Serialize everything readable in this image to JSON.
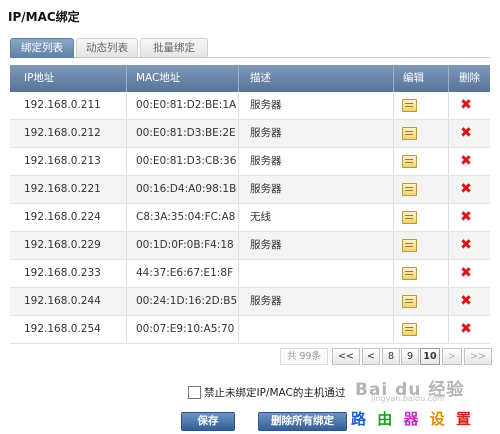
{
  "title": "IP/MAC绑定",
  "tabs": [
    {
      "label": "绑定列表",
      "active": true
    },
    {
      "label": "动态列表",
      "active": false
    },
    {
      "label": "批量绑定",
      "active": false
    }
  ],
  "table": {
    "headers": {
      "ip": "IP地址",
      "mac": "MAC地址",
      "desc": "描述",
      "edit": "编辑",
      "delete": "删除"
    },
    "rows": [
      {
        "ip": "192.168.0.211",
        "mac": "00:E0:81:D2:BE:1A",
        "desc": "服务器"
      },
      {
        "ip": "192.168.0.212",
        "mac": "00:E0:81:D3:BE:2E",
        "desc": "服务器"
      },
      {
        "ip": "192.168.0.213",
        "mac": "00:E0:81:D3:CB:36",
        "desc": "服务器"
      },
      {
        "ip": "192.168.0.221",
        "mac": "00:16:D4:A0:98:1B",
        "desc": "服务器"
      },
      {
        "ip": "192.168.0.224",
        "mac": "C8:3A:35:04:FC:A8",
        "desc": "无线"
      },
      {
        "ip": "192.168.0.229",
        "mac": "00:1D:0F:0B:F4:18",
        "desc": "服务器"
      },
      {
        "ip": "192.168.0.233",
        "mac": "44:37:E6:67:E1:8F",
        "desc": ""
      },
      {
        "ip": "192.168.0.244",
        "mac": "00:24:1D:16:2D:B5",
        "desc": "服务器"
      },
      {
        "ip": "192.168.0.254",
        "mac": "00:07:E9:10:A5:70",
        "desc": ""
      }
    ],
    "edit_icon": "edit-icon",
    "delete_icon": "delete-x-icon",
    "delete_color": "#dd1111"
  },
  "pager": {
    "total": "共 99条",
    "first": "<<",
    "prev": "<",
    "pages": [
      "8",
      "9",
      "10"
    ],
    "current": "10",
    "next": ">",
    "last": ">>"
  },
  "checkbox": {
    "label": "禁止未绑定IP/MAC的主机通过",
    "checked": false
  },
  "buttons": {
    "save": "保存",
    "delete_all": "删除所有绑定"
  },
  "watermark": {
    "brand": "Bai du 经验",
    "url": "jingyan.baidu.com",
    "site": [
      "路",
      "由",
      "器",
      "设",
      "置"
    ],
    "site_colors": [
      "#1e5fcf",
      "#1aa21a",
      "#c72fc4",
      "#e08a00",
      "#d32727"
    ]
  },
  "colors": {
    "header_bg": "#56749a",
    "tab_active": "#6f8fb6",
    "button": "#335f98"
  }
}
